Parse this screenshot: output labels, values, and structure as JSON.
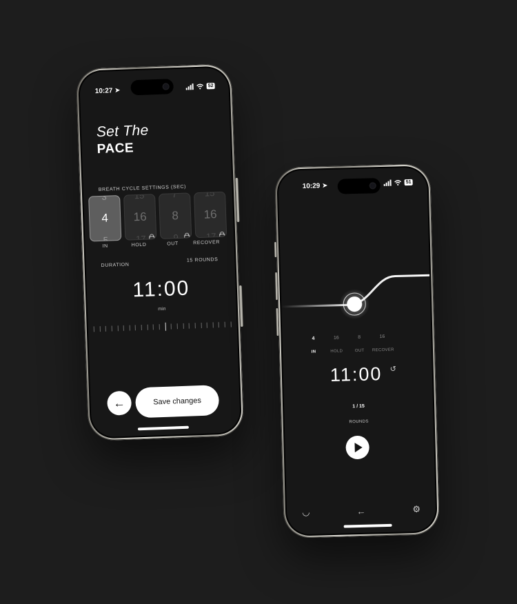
{
  "phone1": {
    "status_time": "10:27",
    "battery": "52",
    "title_italic": "Set The",
    "title_bold": "PACE",
    "cycle_label": "BREATH CYCLE SETTINGS (SEC)",
    "pickers": [
      {
        "value": "4",
        "above": "3",
        "below": "5",
        "label": "IN"
      },
      {
        "value": "16",
        "above": "15",
        "below": "17",
        "label": "HOLD"
      },
      {
        "value": "8",
        "above": "7",
        "below": "9",
        "label": "OUT"
      },
      {
        "value": "16",
        "above": "15",
        "below": "17",
        "label": "RECOVER"
      }
    ],
    "duration_label": "DURATION",
    "rounds_label": "15 ROUNDS",
    "time": "11:00",
    "unit": "min",
    "back_glyph": "←",
    "save_label": "Save changes"
  },
  "phone2": {
    "status_time": "10:29",
    "battery": "51",
    "values": [
      "4",
      "16",
      "8",
      "16"
    ],
    "labels": [
      "IN",
      "HOLD",
      "OUT",
      "RECOVER"
    ],
    "time": "11:00",
    "reset_glyph": "↺",
    "round_counter": "1 / 15",
    "rounds_label": "ROUNDS",
    "nav": {
      "eye_glyph": "◡",
      "back_glyph": "←",
      "settings_glyph": "⚙"
    }
  },
  "icons": [
    "location-arrow-icon",
    "signal-icon",
    "wifi-icon",
    "battery-icon",
    "lock-icon",
    "play-icon",
    "reset-icon",
    "closed-eye-icon",
    "back-arrow-icon",
    "settings-gear-icon"
  ]
}
